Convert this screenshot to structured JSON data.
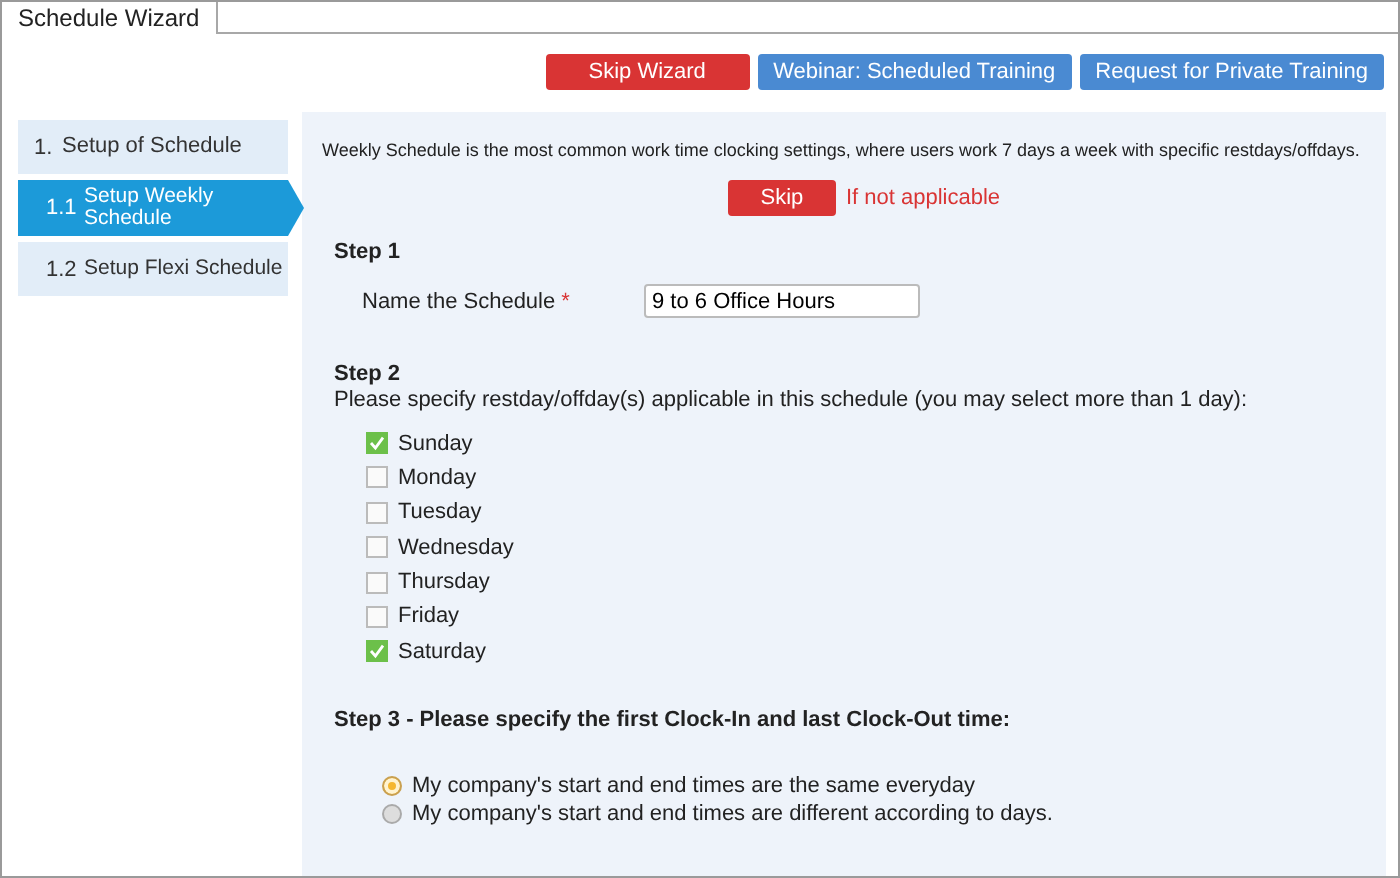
{
  "tabs": [
    {
      "label": "Schedule Wizard",
      "selected": true
    }
  ],
  "top_buttons": [
    {
      "label": "Skip Wizard",
      "kind": "danger"
    },
    {
      "label": "Webinar: Scheduled Training",
      "kind": "primary"
    },
    {
      "label": "Request for Private Training",
      "kind": "primary"
    }
  ],
  "sidebar": {
    "items": [
      {
        "number": "1.",
        "label": "Setup of Schedule",
        "selected": false,
        "children": [
          {
            "number": "1.1",
            "label": "Setup Weekly Schedule",
            "selected": true
          },
          {
            "number": "1.2",
            "label": "Setup Flexi Schedule",
            "selected": false
          }
        ]
      }
    ]
  },
  "intro": "Weekly Schedule is the most common work time clocking settings, where users work 7 days a week with specific restdays/offdays.",
  "skip": {
    "button": "Skip",
    "note": "If not applicable"
  },
  "step1": {
    "title": "Step 1",
    "label": "Name the Schedule",
    "required_mark": "*",
    "value": "9 to 6 Office Hours"
  },
  "step2": {
    "title": "Step 2",
    "description": "Please specify restday/offday(s) applicable in this schedule (you may select more than 1 day):",
    "days": [
      {
        "label": "Sunday",
        "checked": true
      },
      {
        "label": "Monday",
        "checked": false
      },
      {
        "label": "Tuesday",
        "checked": false
      },
      {
        "label": "Wednesday",
        "checked": false
      },
      {
        "label": "Thursday",
        "checked": false
      },
      {
        "label": "Friday",
        "checked": false
      },
      {
        "label": "Saturday",
        "checked": true
      }
    ]
  },
  "step3": {
    "title": "Step 3 - Please specify the first Clock-In and last Clock-Out time:",
    "options": [
      {
        "label": "My company's start and end times are the same everyday",
        "selected": true
      },
      {
        "label": "My company's start and end times are different according to days.",
        "selected": false
      }
    ]
  }
}
